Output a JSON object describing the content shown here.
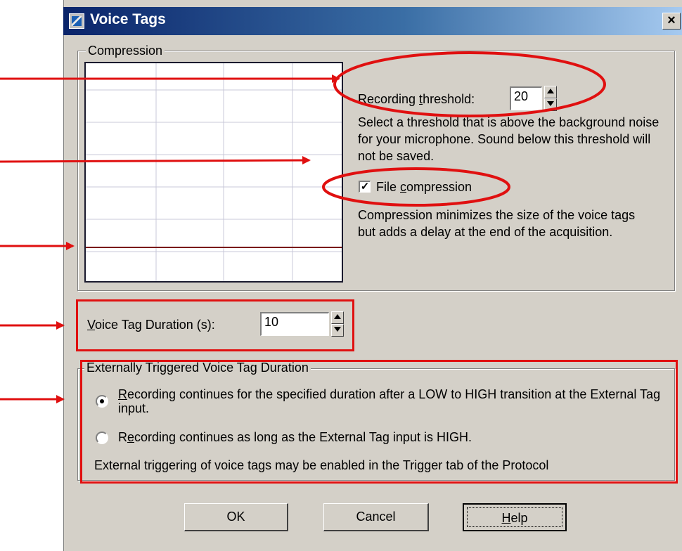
{
  "window": {
    "title": "Voice Tags",
    "close_label": "×"
  },
  "compression_group": {
    "legend": "Compression",
    "recording_threshold": {
      "label_pre": "Recording ",
      "label_mnemonic": "t",
      "label_post": "hreshold:",
      "value": "20"
    },
    "threshold_help": "Select a threshold that is above the background noise for your microphone. Sound below this threshold will not be saved.",
    "file_compression": {
      "checked": true,
      "check_mark": "✓",
      "label_pre": "File ",
      "label_mnemonic": "c",
      "label_post": "ompression"
    },
    "compression_help": "Compression minimizes the size of the voice tags but adds a delay at the end of the acquisition."
  },
  "voice_tag_duration": {
    "label_mnemonic": "V",
    "label_post": "oice Tag Duration (s):",
    "value": "10"
  },
  "external_group": {
    "legend": "Externally Triggered Voice Tag Duration",
    "options": [
      {
        "mnemonic": "R",
        "label": "ecording continues for the specified duration after a LOW to HIGH transition at the External Tag input.",
        "selected": true
      },
      {
        "mnemonic_pre": "R",
        "mnemonic": "e",
        "label": "cording continues as long as the External Tag input is HIGH.",
        "selected": false
      }
    ],
    "note": "External triggering of voice tags may be enabled in the Trigger tab of the Protocol"
  },
  "buttons": {
    "ok": "OK",
    "cancel": "Cancel",
    "help_mnemonic": "H",
    "help_post": "elp"
  },
  "colors": {
    "annotation_red": "#e01010",
    "threshold_line": "#7a1a1a",
    "title_bar": "#0a246a"
  }
}
